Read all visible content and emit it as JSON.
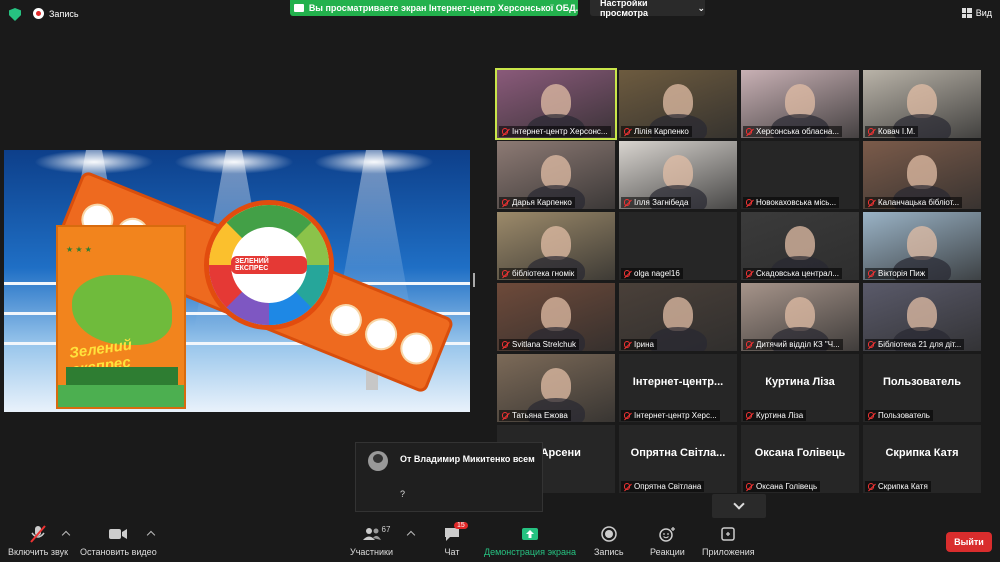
{
  "topbar": {
    "record_label": "Запись",
    "share_banner": "Вы просматриваете экран Інтернет-центр Херсонської ОБД...",
    "view_options": "Настройки просмотра",
    "view_label": "Вид"
  },
  "shared_screen": {
    "wheel_title": "ЗЕЛЕНИЙ ЕКСПРЕС",
    "book_word": "Зелений експрес"
  },
  "participants": [
    {
      "name": "Інтернет-центр Херсонс...",
      "video": true,
      "active": true,
      "bg": "#8a5a7a"
    },
    {
      "name": "Лілія Карпенко",
      "video": true,
      "bg": "#6d5b3f"
    },
    {
      "name": "Херсонська обласна...",
      "video": true,
      "bg": "#c8b0b4"
    },
    {
      "name": "Ковач І.М.",
      "video": true,
      "bg": "#b9b3a8"
    },
    {
      "name": "Дарья Карпенко",
      "video": true,
      "bg": "#8d7a74"
    },
    {
      "name": "Ілля Загнібеда",
      "video": true,
      "bg": "#d8d4cf"
    },
    {
      "name": "Новокаховська місь...",
      "video": false,
      "bg": "#262626"
    },
    {
      "name": "Каланчацька бібліот...",
      "video": true,
      "bg": "#7b5b4a"
    },
    {
      "name": "бібліотека гномік",
      "video": true,
      "bg": "#9c8a6a"
    },
    {
      "name": "olga nagel16",
      "video": false,
      "bg": "#262626"
    },
    {
      "name": "Скадовська централ...",
      "video": true,
      "bg": "#3b3b3b"
    },
    {
      "name": "Вікторія Пиж",
      "video": true,
      "bg": "#9ab3c6"
    },
    {
      "name": "Svitlana Strelchuk",
      "video": true,
      "bg": "#6e4a3a"
    },
    {
      "name": "Ірина",
      "video": true,
      "bg": "#4a4039"
    },
    {
      "name": "Дитячий відділ КЗ \"Ч...",
      "video": true,
      "bg": "#a6948a"
    },
    {
      "name": "Бібліотека 21 для діт...",
      "video": true,
      "bg": "#5a5a6a"
    },
    {
      "name": "Татьяна Ежова",
      "video": true,
      "bg": "#7c6a58"
    },
    {
      "name": "Інтернет-центр Херс...",
      "big": "Інтернет-центр...",
      "video": false,
      "bg": "#262626"
    },
    {
      "name": "Куртина Ліза",
      "big": "Куртина Ліза",
      "video": false,
      "bg": "#262626"
    },
    {
      "name": "Пользователь",
      "big": "Пользователь",
      "video": false,
      "bg": "#262626"
    },
    {
      "name": "Арсени",
      "big": "я Арсени",
      "video": false,
      "bg": "#262626"
    },
    {
      "name": "Опрятна Світлана",
      "big": "Опрятна Світла...",
      "video": false,
      "bg": "#262626"
    },
    {
      "name": "Оксана Голівець",
      "big": "Оксана Голівець",
      "video": false,
      "bg": "#262626"
    },
    {
      "name": "Скрипка Катя",
      "big": "Скрипка Катя",
      "video": false,
      "bg": "#262626"
    }
  ],
  "chat_toast": {
    "from": "От Владимир Микитенко всем",
    "message": "?"
  },
  "toolbar": {
    "unmute": "Включить звук",
    "stop_video": "Остановить видео",
    "participants": "Участники",
    "participants_count": "67",
    "chat": "Чат",
    "chat_badge": "15",
    "share": "Демонстрация экрана",
    "record": "Запись",
    "reactions": "Реакции",
    "apps": "Приложения",
    "leave": "Выйти"
  },
  "colors": {
    "accent_green": "#26c281",
    "leave_red": "#d92d2d",
    "active_speaker": "#c9e54a"
  }
}
